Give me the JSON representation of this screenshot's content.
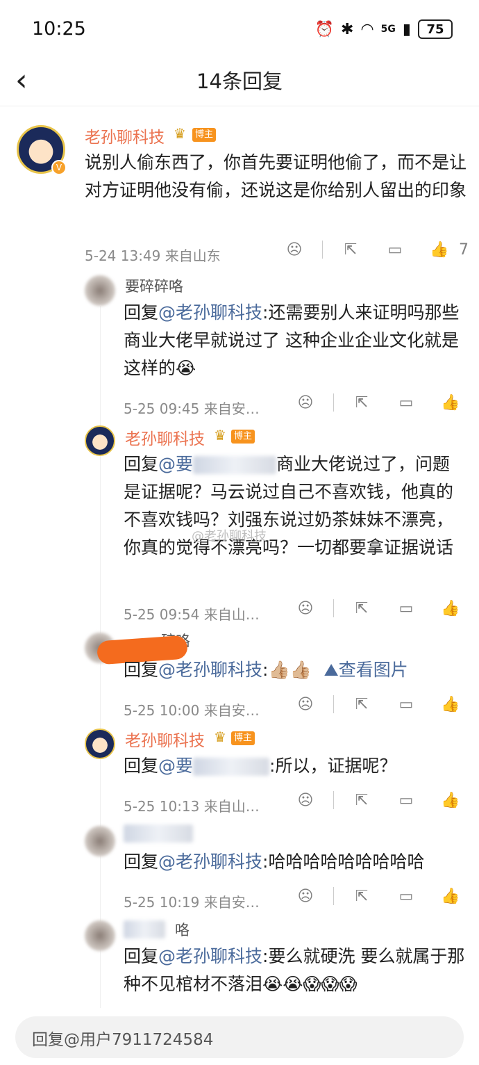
{
  "status": {
    "time": "10:25",
    "network": "5G",
    "battery": "75"
  },
  "header": {
    "back_icon": "chevron-left-icon",
    "title": "14条回复"
  },
  "main_comment": {
    "author": "老孙聊科技",
    "badge": "博主",
    "text": "说别人偷东西了，你首先要证明他偷了，而不是让对方证明他没有偷，还说这是你给别人留出的印象",
    "meta": "5-24 13:49 来自山东",
    "likes": "7"
  },
  "replies": [
    {
      "author": "要碎碎咯",
      "prefix": "回复",
      "mention": "@老孙聊科技",
      "text": ":还需要别人来证明吗那些商业大佬早就说过了 这种企业企业文化就是这样的😭",
      "meta": "5-25 09:45 来自安…"
    },
    {
      "author": "老孙聊科技",
      "badge": "博主",
      "prefix": "回复",
      "mention": "@要",
      "text": "商业大佬说过了，问题是证据呢？马云说过自己不喜欢钱，他真的不喜欢钱吗？刘强东说过奶茶妹妹不漂亮，你真的觉得不漂亮吗？一切都要拿证据说话",
      "meta": "5-25 09:54 来自山…"
    },
    {
      "author": "碎咯",
      "prefix": "回复",
      "mention": "@老孙聊科技",
      "text": ":👍🏼👍🏼",
      "link": "查看图片",
      "meta": "5-25 10:00 来自安…"
    },
    {
      "author": "老孙聊科技",
      "badge": "博主",
      "prefix": "回复",
      "mention": "@要",
      "text": ":所以，证据呢？",
      "meta": "5-25 10:13 来自山…"
    },
    {
      "author": "",
      "prefix": "回复",
      "mention": "@老孙聊科技",
      "text": ":哈哈哈哈哈哈哈哈哈",
      "meta": "5-25 10:19 来自安…"
    },
    {
      "author": "咯",
      "prefix": "回复",
      "mention": "@老孙聊科技",
      "text": ":要么就硬洗 要么就属于那种不见棺材不落泪😭😭😱😱😱",
      "meta": ""
    }
  ],
  "watermark": "@老孙聊科技",
  "reply_input": {
    "placeholder": "回复@用户7911724584"
  },
  "icons": {
    "dislike": "sad-face-icon",
    "share": "share-icon",
    "comment": "comment-icon",
    "like": "thumbs-up-icon"
  }
}
